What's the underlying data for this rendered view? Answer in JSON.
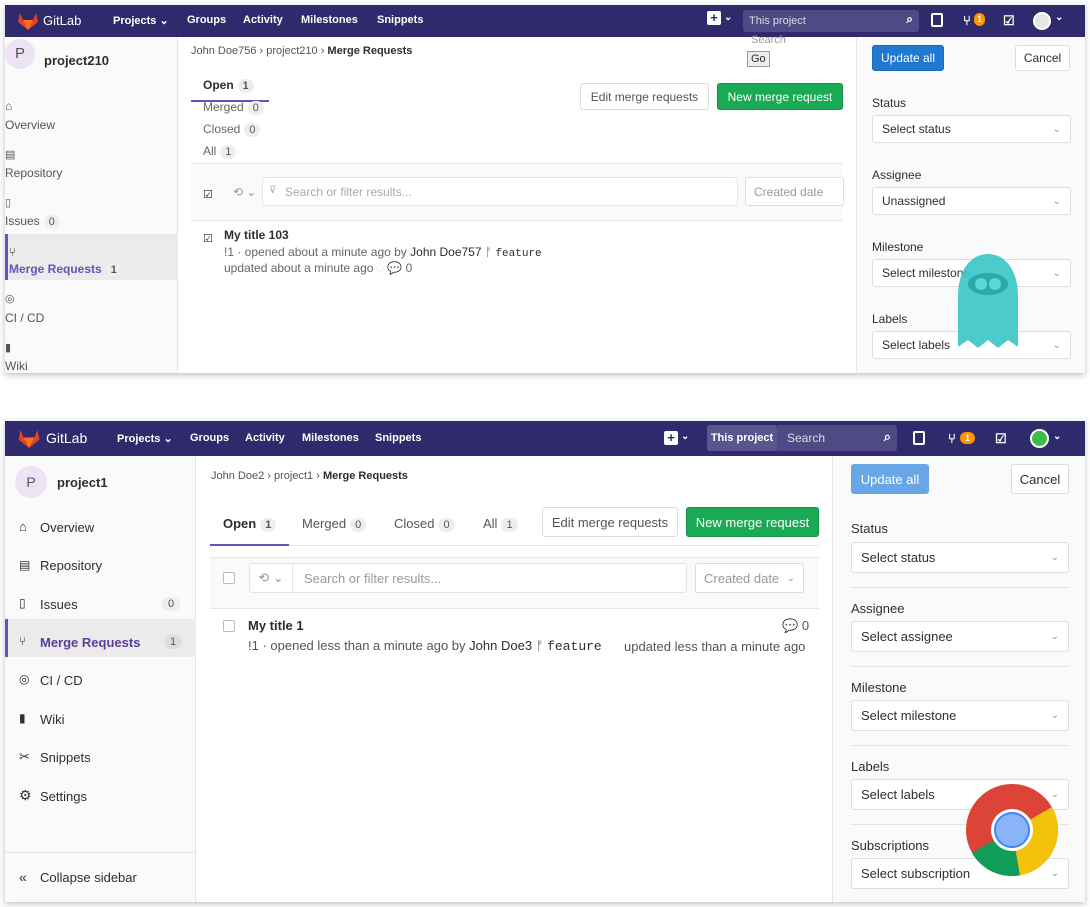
{
  "top": {
    "nav": {
      "brand": "GitLab",
      "projects": "Projects",
      "groups": "Groups",
      "activity": "Activity",
      "milestones": "Milestones",
      "snippets": "Snippets",
      "search_placeholder": "This project",
      "todo_count": "1",
      "colors": {
        "bar": "#2f2a6b",
        "badge": "#fc9403"
      }
    },
    "project": {
      "avatar": "P",
      "name": "project210"
    },
    "sidebar": {
      "overview": "Overview",
      "repository": "Repository",
      "issues": "Issues",
      "issues_count": "0",
      "merge_requests": "Merge Requests",
      "mr_count": "1",
      "cicd": "CI / CD",
      "wiki": "Wiki"
    },
    "breadcrumb": {
      "user": "John Doe756",
      "project": "project210",
      "current": "Merge Requests"
    },
    "search": {
      "placeholder": "Search",
      "go": "Go"
    },
    "tabs": {
      "open": "Open",
      "open_count": "1",
      "merged": "Merged",
      "merged_count": "0",
      "closed": "Closed",
      "closed_count": "0",
      "all": "All",
      "all_count": "1"
    },
    "buttons": {
      "edit": "Edit merge requests",
      "new": "New merge request"
    },
    "filter": {
      "placeholder": "Search or filter results...",
      "sort": "Created date"
    },
    "mr": {
      "title": "My title 103",
      "ref": "!1 · opened about a minute ago by",
      "author": "John Doe757",
      "branch": "feature",
      "updated": "updated about a minute ago",
      "comments": "0"
    },
    "right": {
      "update_all": "Update all",
      "cancel": "Cancel",
      "status_label": "Status",
      "status_value": "Select status",
      "assignee_label": "Assignee",
      "assignee_value": "Unassigned",
      "milestone_label": "Milestone",
      "milestone_value": "Select milestone",
      "labels_label": "Labels",
      "labels_value": "Select labels"
    }
  },
  "bottom": {
    "nav": {
      "brand": "GitLab",
      "projects": "Projects",
      "groups": "Groups",
      "activity": "Activity",
      "milestones": "Milestones",
      "snippets": "Snippets",
      "scope": "This project",
      "search_placeholder": "Search",
      "todo_count": "1"
    },
    "project": {
      "avatar": "P",
      "name": "project1"
    },
    "sidebar": {
      "overview": "Overview",
      "repository": "Repository",
      "issues": "Issues",
      "issues_count": "0",
      "merge_requests": "Merge Requests",
      "mr_count": "1",
      "cicd": "CI / CD",
      "wiki": "Wiki",
      "snippets": "Snippets",
      "settings": "Settings",
      "collapse": "Collapse sidebar"
    },
    "breadcrumb": {
      "user": "John Doe2",
      "project": "project1",
      "current": "Merge Requests"
    },
    "tabs": {
      "open": "Open",
      "open_count": "1",
      "merged": "Merged",
      "merged_count": "0",
      "closed": "Closed",
      "closed_count": "0",
      "all": "All",
      "all_count": "1"
    },
    "buttons": {
      "edit": "Edit merge requests",
      "new": "New merge request"
    },
    "filter": {
      "placeholder": "Search or filter results...",
      "sort": "Created date"
    },
    "mr": {
      "title": "My title 1",
      "ref": "!1 · opened less than a minute ago by",
      "author": "John Doe3",
      "branch": "feature",
      "updated": "updated less than a minute ago",
      "comments": "0"
    },
    "right": {
      "update_all": "Update all",
      "cancel": "Cancel",
      "status_label": "Status",
      "status_value": "Select status",
      "assignee_label": "Assignee",
      "assignee_value": "Select assignee",
      "milestone_label": "Milestone",
      "milestone_value": "Select milestone",
      "labels_label": "Labels",
      "labels_value": "Select labels",
      "subscriptions_label": "Subscriptions",
      "subscriptions_value": "Select subscription"
    }
  }
}
